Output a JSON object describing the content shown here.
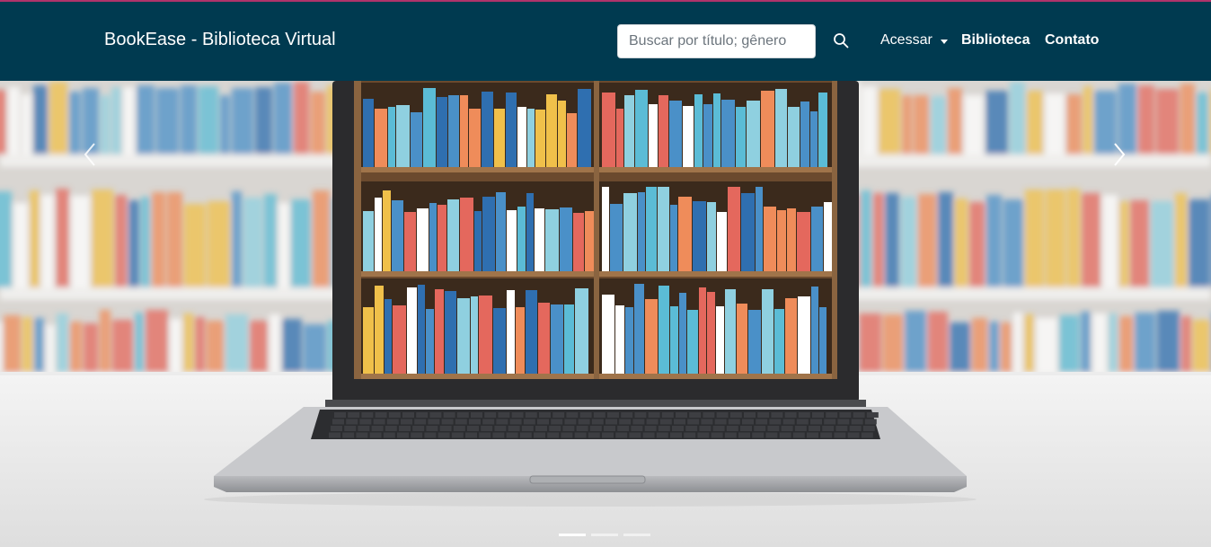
{
  "navbar": {
    "brand": "BookEase - Biblioteca Virtual",
    "search": {
      "placeholder": "Buscar por título; gênero",
      "value": ""
    },
    "search_icon": "search-icon",
    "links": [
      {
        "label": "Acessar",
        "has_dropdown": true
      },
      {
        "label": "Biblioteca"
      },
      {
        "label": "Contato"
      }
    ]
  },
  "carousel": {
    "slide_count": 3,
    "active_index": 0,
    "prev_icon": "chevron-left-icon",
    "next_icon": "chevron-right-icon"
  },
  "colors": {
    "navbar_bg": "#003a50",
    "accent": "#b0336a",
    "text": "#ffffff"
  }
}
